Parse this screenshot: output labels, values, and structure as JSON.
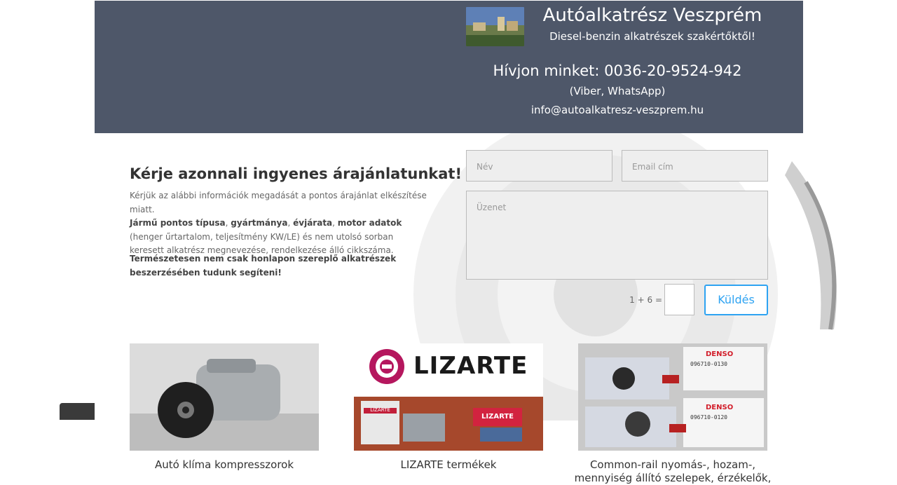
{
  "header": {
    "title": "Autóalkatrész Veszprém",
    "subtitle": "Diesel-benzin alkatrészek szakértőktől!",
    "phone": "Hívjon minket: 0036-20-9524-942",
    "phone_note": "(Viber, WhatsApp)",
    "email": "info@autoalkatresz-veszprem.hu"
  },
  "cta": {
    "title": "Kérje azonnali ingyenes árajánlatunkat!",
    "intro": "Kérjük az alábbi információk megadását a pontos árajánlat elkészítése miatt.",
    "b1": "Jármű pontos típusa",
    "s1": ", ",
    "b2": "gyártmánya",
    "s2": ", ",
    "b3": "évjárata",
    "s3": ", ",
    "b4": "motor adatok",
    "rest": " (henger űrtartalom, teljesítmény KW/LE) és nem utolsó sorban keresett alkatrész megnevezése, rendelkezése álló cikkszáma.",
    "bold_note": "Természetesen nem csak honlapon szereplő alkatrészek beszerzésében tudunk segíteni!"
  },
  "form": {
    "name_placeholder": "Név",
    "email_placeholder": "Email cím",
    "message_placeholder": "Üzenet",
    "captcha_label": "1 + 6 =",
    "submit_label": "Küldés"
  },
  "cards": [
    {
      "caption": "Autó klíma kompresszorok"
    },
    {
      "caption": "LIZARTE termékek",
      "logo_text": "LIZARTE",
      "box_label": "LIZARTE"
    },
    {
      "caption": "Common-rail nyomás-, hozam-, mennyiség állító szelepek, érzékelők,",
      "brand": "DENSO",
      "code1": "096710-0130",
      "code2": "096710-0120"
    }
  ],
  "colors": {
    "header_bg": "#4e5769",
    "accent": "#2ea3f2",
    "lizarte": "#b5175e"
  }
}
